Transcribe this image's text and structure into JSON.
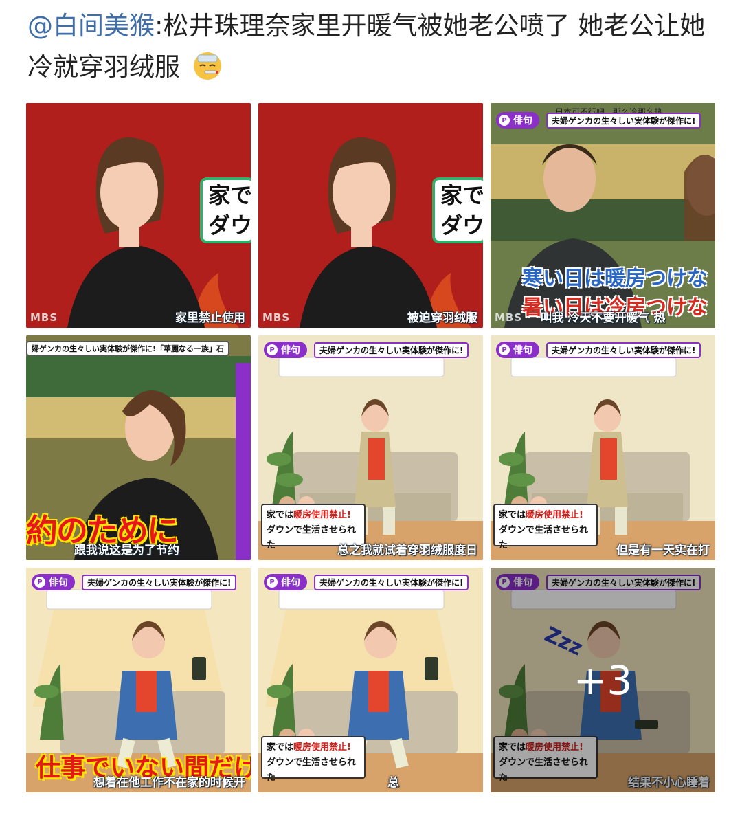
{
  "post": {
    "mention": "@白间美猴",
    "text": ":松井珠理奈家里开暖气被她老公喷了 她老公让她冷就穿羽绒服",
    "emoji": "sick-face-emoji"
  },
  "tiles": [
    {
      "subtitle": "家里禁止使用",
      "sign": "家で\nダウン",
      "logo": "MBS"
    },
    {
      "subtitle": "被迫穿羽绒服",
      "sign": "家で\nダウン",
      "logo": "MBS"
    },
    {
      "overtitle": "日本可不行吧，那么冷那么热",
      "badge": "俳句",
      "headline": "夫婦ゲンカの生々しい実体験が傑作に!",
      "caption1": "寒い日は暖房つけな",
      "caption2": "暑い日は冷房つけな",
      "subtitle": "叫我 冷天不要开暖气 热",
      "logo": "MBS"
    },
    {
      "headline": "婦ゲンカの生々しい実体験が傑作に!「華麗なる一族」石",
      "caption": "約のために",
      "subtitle": "跟我说这是为了节约"
    },
    {
      "badge": "俳句",
      "headline": "夫婦ゲンカの生々しい実体験が傑作に!",
      "sign_line1a": "家では",
      "sign_line1b": "暖房使用禁止!",
      "sign_line2": "ダウンで生活させられた",
      "subtitle": "总之我就试着穿羽绒服度日"
    },
    {
      "badge": "俳句",
      "headline": "夫婦ゲンカの生々しい実体験が傑作に!",
      "sign_line1a": "家では",
      "sign_line1b": "暖房使用禁止!",
      "sign_line2": "ダウンで生活させられた",
      "subtitle": "但是有一天实在打"
    },
    {
      "badge": "俳句",
      "headline": "夫婦ゲンカの生々しい実体験が傑作に!",
      "caption": "仕事でいない間だけ",
      "subtitle": "想着在他工作不在家的时候开"
    },
    {
      "badge": "俳句",
      "headline": "夫婦ゲンカの生々しい実体験が傑作に!",
      "sign_line1a": "家では",
      "sign_line1b": "暖房使用禁止!",
      "sign_line2": "ダウンで生活させられた",
      "subtitle": "总"
    },
    {
      "badge": "俳句",
      "headline": "夫婦ゲンカの生々しい実体験が傑作に!",
      "sign_line1a": "家では",
      "sign_line1b": "暖房使用禁止!",
      "sign_line2": "ダウンで生活させられた",
      "subtitle": "结果不小心睡着",
      "more": "+3",
      "zzz": "Zzz"
    }
  ]
}
